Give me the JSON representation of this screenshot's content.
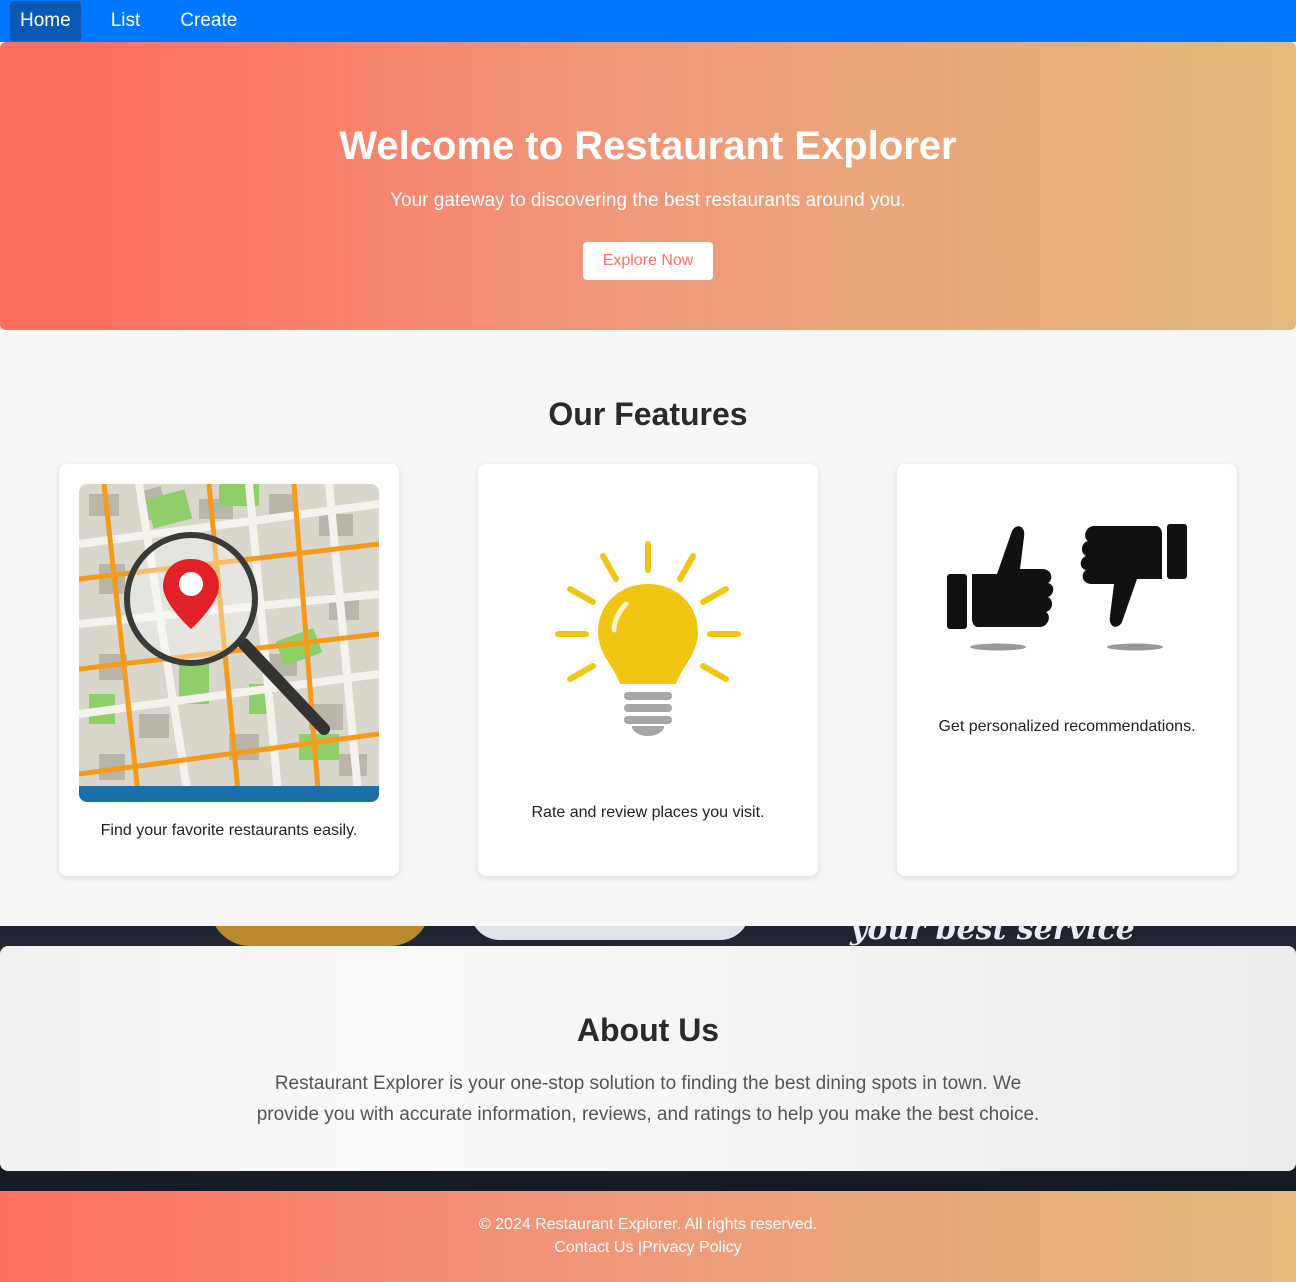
{
  "nav": {
    "items": [
      {
        "label": "Home",
        "active": true
      },
      {
        "label": "List",
        "active": false
      },
      {
        "label": "Create",
        "active": false
      }
    ]
  },
  "hero": {
    "title": "Welcome to Restaurant Explorer",
    "subtitle": "Your gateway to discovering the best restaurants around you.",
    "button": "Explore Now"
  },
  "features": {
    "heading": "Our Features",
    "cards": [
      {
        "icon": "map-search-icon",
        "caption": "Find your favorite restaurants easily."
      },
      {
        "icon": "lightbulb-icon",
        "caption": "Rate and review places you visit."
      },
      {
        "icon": "thumbs-up-down-icon",
        "caption": "Get personalized recommendations."
      }
    ]
  },
  "about": {
    "heading": "About Us",
    "text": "Restaurant Explorer is your one-stop solution to finding the best dining spots in town. We provide you with accurate information, reviews, and ratings to help you make the best choice.",
    "background_text": "your best service"
  },
  "footer": {
    "copyright": "© 2024 Restaurant Explorer. All rights reserved.",
    "contact": "Contact Us",
    "separator": " |",
    "privacy": "Privacy Policy"
  },
  "colors": {
    "nav": "#0077ff",
    "nav_active": "#0a5ab5",
    "accent": "#ff6f5f",
    "gradient_end": "#e2bb79"
  }
}
